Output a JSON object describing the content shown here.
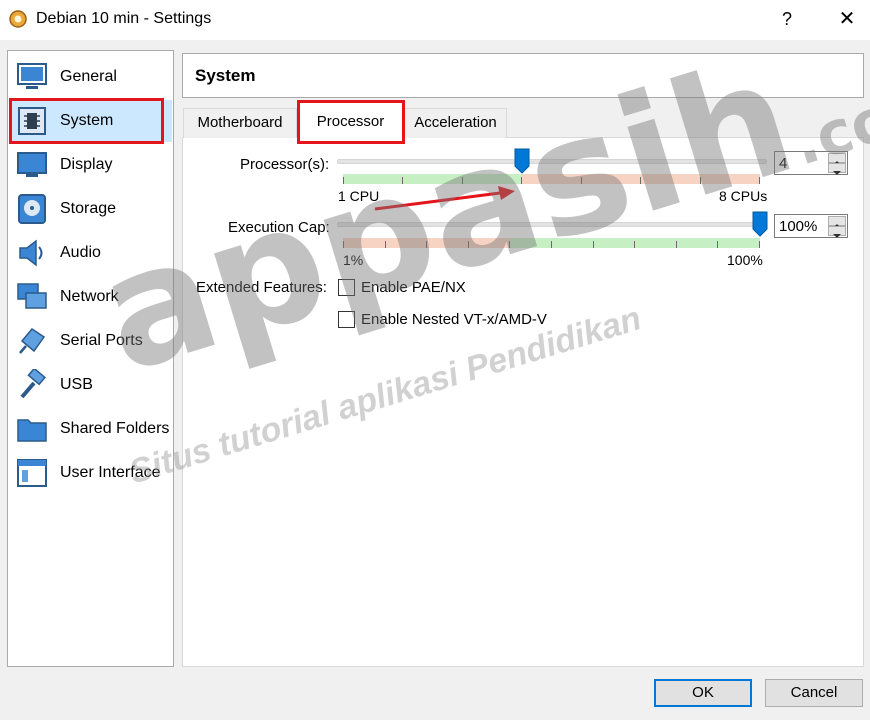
{
  "window": {
    "title": "Debian 10 min - Settings",
    "help": "?",
    "close": "✕"
  },
  "sidebar": {
    "items": [
      {
        "label": "General",
        "icon": "monitor-icon"
      },
      {
        "label": "System",
        "icon": "chip-icon"
      },
      {
        "label": "Display",
        "icon": "display-icon"
      },
      {
        "label": "Storage",
        "icon": "disk-icon"
      },
      {
        "label": "Audio",
        "icon": "speaker-icon"
      },
      {
        "label": "Network",
        "icon": "network-icon"
      },
      {
        "label": "Serial Ports",
        "icon": "serial-port-icon"
      },
      {
        "label": "USB",
        "icon": "usb-icon"
      },
      {
        "label": "Shared Folders",
        "icon": "folder-icon"
      },
      {
        "label": "User Interface",
        "icon": "window-icon"
      }
    ],
    "selected": "System"
  },
  "header": {
    "title": "System"
  },
  "tabs": [
    {
      "label": "Motherboard"
    },
    {
      "label": "Processor"
    },
    {
      "label": "Acceleration"
    }
  ],
  "active_tab": "Processor",
  "processor": {
    "label": "Processor(s):",
    "value": "4",
    "min_label": "1 CPU",
    "max_label": "8 CPUs",
    "level": 4,
    "max": 8
  },
  "execution_cap": {
    "label": "Execution Cap:",
    "value": "100%",
    "min_label": "1%",
    "max_label": "100%",
    "level_percent": 100
  },
  "extended_features": {
    "label": "Extended Features:",
    "pae": {
      "label": "Enable PAE/NX",
      "checked": false
    },
    "nested": {
      "label": "Enable Nested VT-x/AMD-V",
      "checked": false
    }
  },
  "buttons": {
    "ok": "OK",
    "cancel": "Cancel"
  },
  "watermark": {
    "brand": "appasih",
    "domain": ".com",
    "tagline": "Situs tutorial aplikasi Pendidikan"
  },
  "colors": {
    "highlight": "#e4141b",
    "selected_bg": "#cce8ff",
    "green": "#c6efc4",
    "red": "#f7d3c4",
    "accent": "#0078d7"
  }
}
